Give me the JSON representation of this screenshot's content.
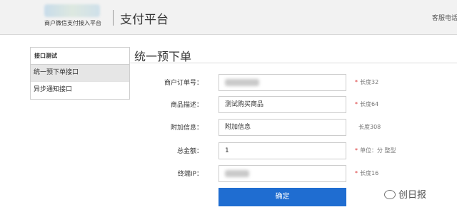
{
  "header": {
    "logo_subtitle": "商户微信支付接入平台",
    "brand_title": "支付平台",
    "top_right_link": "客服电话"
  },
  "sidebar": {
    "heading": "接口测试",
    "items": [
      {
        "label": "统一预下单接口",
        "active": true
      },
      {
        "label": "异步通知接口",
        "active": false
      }
    ]
  },
  "page": {
    "title": "统一预下单"
  },
  "form": {
    "fields": [
      {
        "label": "商户订单号：",
        "value": "",
        "required": true,
        "hint": "长度32"
      },
      {
        "label": "商品描述：",
        "value": "测试购买商品",
        "required": true,
        "hint": "长度64"
      },
      {
        "label": "附加信息：",
        "value": "附加信息",
        "required": false,
        "hint": "长度308"
      },
      {
        "label": "总金额：",
        "value": "1",
        "required": true,
        "hint": "单位：分 整型"
      },
      {
        "label": "终端IP：",
        "value": "",
        "required": true,
        "hint": "长度16"
      }
    ],
    "submit_label": "确定"
  },
  "watermark": {
    "text": "创日报"
  },
  "colors": {
    "primary_button": "#1f6dd1",
    "required_star": "#d83030"
  }
}
